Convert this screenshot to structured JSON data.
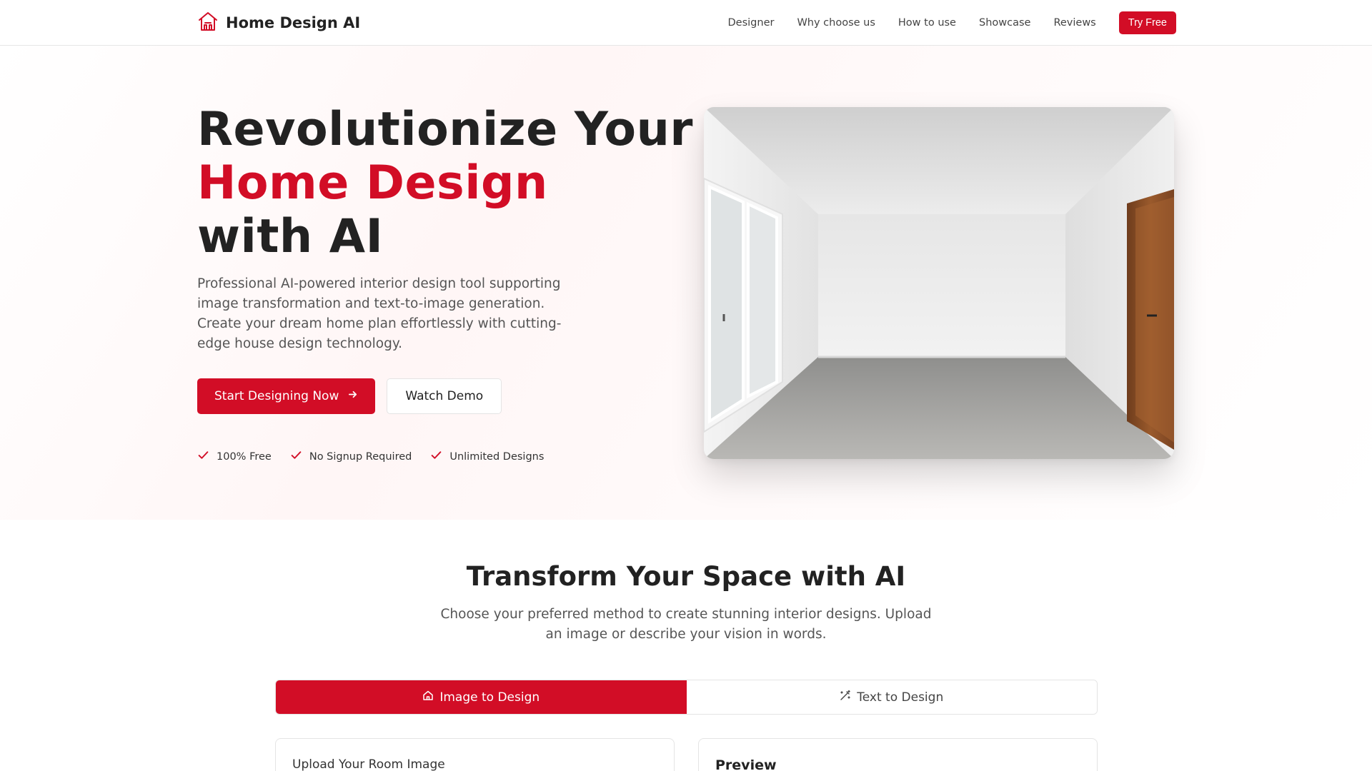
{
  "header": {
    "brand": "Home Design AI",
    "nav": [
      "Designer",
      "Why choose us",
      "How to use",
      "Showcase",
      "Reviews"
    ],
    "cta": "Try Free"
  },
  "hero": {
    "title_line1": "Revolutionize Your",
    "title_line2": "Home Design",
    "title_line3": "with AI",
    "description": "Professional AI-powered interior design tool supporting image transformation and text-to-image generation. Create your dream home plan effortlessly with cutting-edge house design technology.",
    "primary_button": "Start Designing Now",
    "secondary_button": "Watch Demo",
    "perks": [
      "100% Free",
      "No Signup Required",
      "Unlimited Designs"
    ]
  },
  "transform": {
    "title": "Transform Your Space with AI",
    "subtitle": "Choose your preferred method to create stunning interior designs. Upload an image or describe your vision in words.",
    "tabs": [
      "Image to Design",
      "Text to Design"
    ],
    "upload_label": "Upload Your Room Image",
    "preview_title": "Preview"
  },
  "colors": {
    "accent": "#d20d26",
    "text": "#222222",
    "muted": "#555555"
  },
  "icons": {
    "logo": "house-logo-icon",
    "arrow": "arrow-right-icon",
    "check": "check-icon",
    "home_tab": "home-icon",
    "wand_tab": "magic-wand-icon"
  }
}
